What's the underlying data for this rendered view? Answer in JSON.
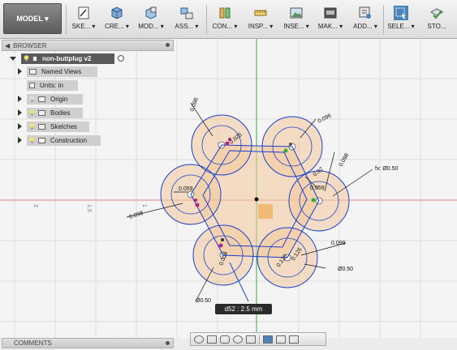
{
  "toolbar": {
    "workspace": "MODEL ▾",
    "tools": [
      {
        "label": "SKE... ▾",
        "icon": "sketch-icon"
      },
      {
        "label": "CRE... ▾",
        "icon": "create-icon"
      },
      {
        "label": "MOD... ▾",
        "icon": "modify-icon"
      },
      {
        "label": "ASS... ▾",
        "icon": "assemble-icon"
      },
      {
        "label": "CON... ▾",
        "icon": "construct-icon"
      },
      {
        "label": "INSP... ▾",
        "icon": "inspect-icon"
      },
      {
        "label": "INSE... ▾",
        "icon": "insert-icon"
      },
      {
        "label": "MAK... ▾",
        "icon": "make-icon"
      },
      {
        "label": "ADD... ▾",
        "icon": "addins-icon"
      },
      {
        "label": "SELE... ▾",
        "icon": "select-icon"
      },
      {
        "label": "STO...",
        "icon": "stop-sketch-icon"
      }
    ]
  },
  "browser": {
    "title": "BROWSER",
    "root": "non-buttplug v2",
    "items": [
      "Named Views",
      "Units: in",
      "Origin",
      "Bodies",
      "Sketches",
      "Construction"
    ]
  },
  "comments": {
    "title": "COMMENTS"
  },
  "viewport": {
    "axis_ticks": [
      "2",
      "1.5",
      "1"
    ],
    "dims": {
      "d_topleft": "0.098",
      "d_topright": "0.096",
      "d_right1": "0.098",
      "d_right2": "0.92",
      "d_right3": "0.059",
      "fx": "fx: Ø0.50",
      "d_left1": "0.059",
      "d_left2": "0.098",
      "d_botright": "0.099",
      "d_dia_right": "Ø0.50",
      "d_dia_left": "Ø0.50",
      "d_small1": "0.056",
      "d_small2": "0.025",
      "d_small3": "0.120",
      "d_small4": "0.125"
    },
    "input_tip": "d52 : 2.5 mm"
  },
  "colors": {
    "accent": "#4a83b8",
    "sketch_blue": "#1a3fcf",
    "fill": "#f3c99a",
    "axis_green": "#2fae3a",
    "axis_red": "#d04040"
  }
}
